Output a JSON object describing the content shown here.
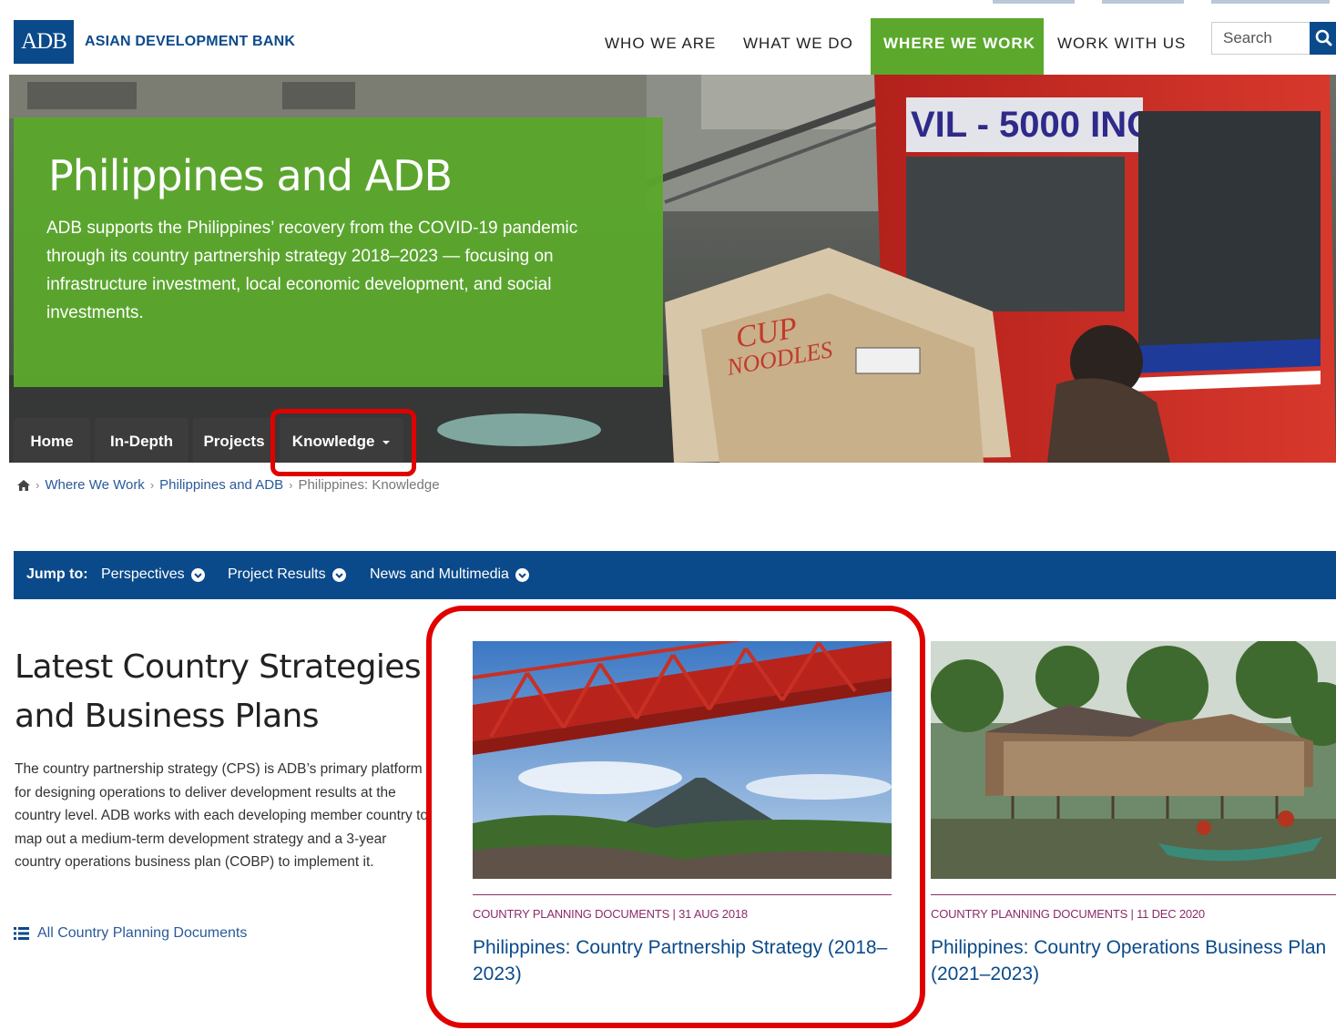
{
  "header": {
    "logo_text": "ADB",
    "org_name": "ASIAN DEVELOPMENT BANK",
    "nav": [
      {
        "label": "WHO WE ARE",
        "active": false
      },
      {
        "label": "WHAT WE DO",
        "active": false
      },
      {
        "label": "WHERE WE WORK",
        "active": true
      },
      {
        "label": "WORK WITH US",
        "active": false
      }
    ],
    "search_placeholder": "Search",
    "search_icon": "magnifier-icon"
  },
  "hero": {
    "title": "Philippines and ADB",
    "description": "ADB supports the Philippines’ recovery from the COVID-19 pandemic through its country partnership strategy 2018–2023 — focusing on infrastructure investment, local economic development, and social investments.",
    "photo_sign_text": "VIL - 5000 INC.",
    "tabs": [
      {
        "label": "Home"
      },
      {
        "label": "In-Depth"
      },
      {
        "label": "Projects"
      },
      {
        "label": "Knowledge",
        "has_dropdown": true,
        "highlighted": true
      }
    ]
  },
  "breadcrumb": {
    "home_icon": "home-icon",
    "items": [
      "Where We Work",
      "Philippines and ADB",
      "Philippines: Knowledge"
    ]
  },
  "jumpbar": {
    "label": "Jump to:",
    "links": [
      "Perspectives",
      "Project Results",
      "News and Multimedia"
    ]
  },
  "strategies": {
    "title": "Latest Country Strategies and Business Plans",
    "description": "The country partnership strategy (CPS) is ADB’s primary platform for designing operations to deliver development results at the country level. ADB works with each developing member country to map out a medium-term development strategy and a 3-year country operations business plan (COBP) to implement it.",
    "all_docs_link": "All Country Planning Documents",
    "cards": [
      {
        "category": "COUNTRY PLANNING DOCUMENTS",
        "date": "31 AUG 2018",
        "meta": "COUNTRY PLANNING DOCUMENTS | 31 AUG 2018",
        "title": "Philippines: Country Partnership Strategy (2018–2023)",
        "image": "red-bridge-volcano-photo",
        "highlighted": true
      },
      {
        "category": "COUNTRY PLANNING DOCUMENTS",
        "date": "11 DEC 2020",
        "meta": "COUNTRY PLANNING DOCUMENTS | 11 DEC 2020",
        "title": "Philippines: Country Operations Business Plan (2021–2023)",
        "image": "stilt-houses-river-photo",
        "highlighted": false
      }
    ]
  },
  "colors": {
    "brand_blue": "#0b4a8a",
    "brand_green": "#5ba82d",
    "meta_purple": "#8b2c6a",
    "highlight_red": "#e00000"
  }
}
